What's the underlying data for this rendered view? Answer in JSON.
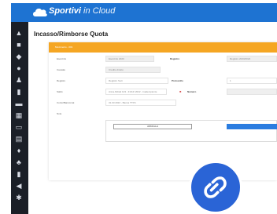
{
  "app": {
    "brand_bold": "Sportivi",
    "brand_light": "in Cloud"
  },
  "page": {
    "title": "Incasso/Rimborse Quota"
  },
  "panel": {
    "header": "Movimento - 001"
  },
  "form": {
    "rows": [
      {
        "label": "Esercizio",
        "value": "Esercizio 2023",
        "label2": "Registro",
        "value2": "Registro 2023/2024"
      },
      {
        "label": "Causale",
        "value": "Credito diretto"
      },
      {
        "label": "Registro",
        "value": "Registro Soci",
        "label2": "Protocollo",
        "value2": "1"
      },
      {
        "label": "Saldo",
        "value": "Anna Abbati 123 - 31/12/ 2022 - Inadempiente",
        "label2": "Numero",
        "value2": ""
      },
      {
        "label": "Conto/Bancomat",
        "value": "31.03.2022 - Banca TTFS"
      },
      {
        "label": "Note",
        "value": ""
      }
    ],
    "cancel_label": "ANNULLA",
    "save_label": ""
  }
}
